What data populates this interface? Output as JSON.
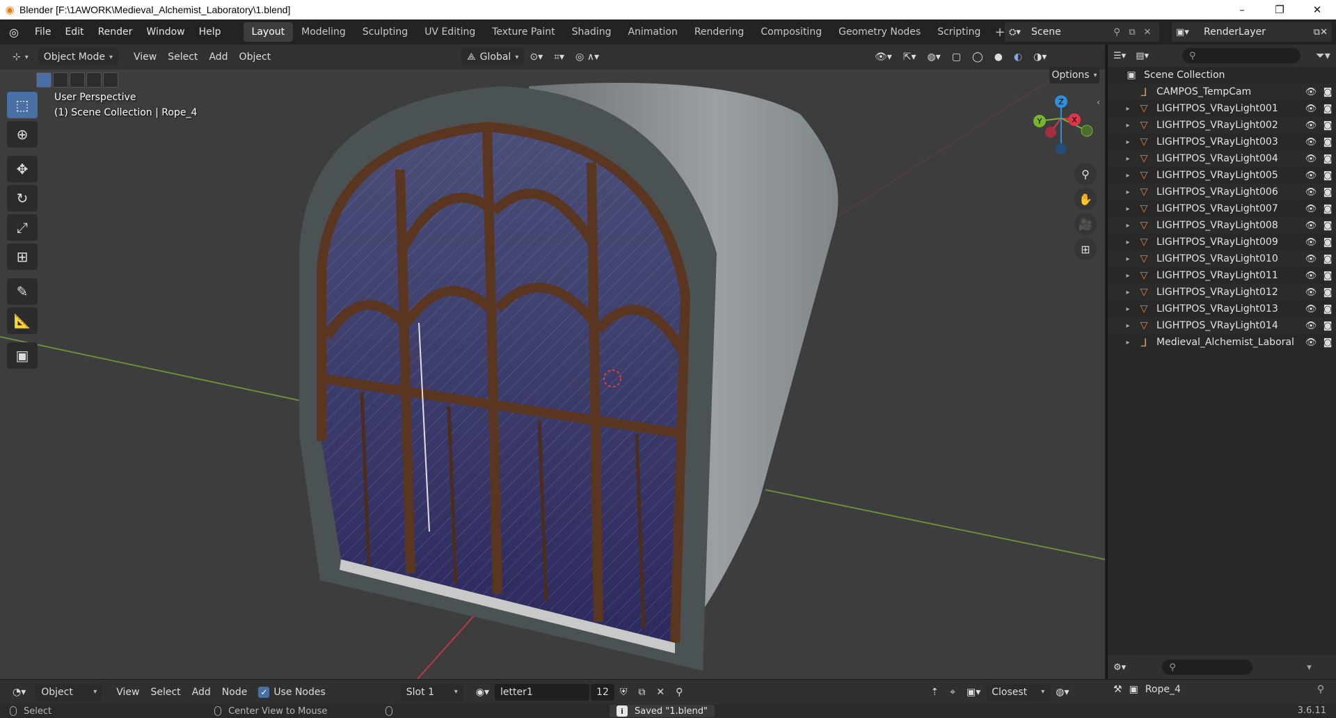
{
  "window": {
    "title": "Blender [F:\\1AWORK\\Medieval_Alchemist_Laboratory\\1.blend]",
    "controls": [
      "–",
      "❐",
      "✕"
    ]
  },
  "menus": [
    "File",
    "Edit",
    "Render",
    "Window",
    "Help"
  ],
  "workspaces": [
    "Layout",
    "Modeling",
    "Sculpting",
    "UV Editing",
    "Texture Paint",
    "Shading",
    "Animation",
    "Rendering",
    "Compositing",
    "Geometry Nodes",
    "Scripting"
  ],
  "active_workspace": "Layout",
  "scene": {
    "name": "Scene"
  },
  "view_layer": {
    "name": "RenderLayer"
  },
  "viewport": {
    "mode": "Object Mode",
    "menus": [
      "View",
      "Select",
      "Add",
      "Object"
    ],
    "transform_orientation": "Global",
    "perspective_label": "User Perspective",
    "context_label": "(1) Scene Collection | Rope_4",
    "options_label": "Options",
    "gizmo_axes": {
      "x": "X",
      "y": "Y",
      "z": "Z"
    },
    "colors": {
      "x_axis": "#e0364a",
      "y_axis": "#78b42e",
      "z_axis": "#2f8fd8",
      "background": "#3d3d3d"
    }
  },
  "tools": [
    "select-box-icon",
    "cursor-icon",
    "move-icon",
    "rotate-icon",
    "scale-icon",
    "transform-icon",
    "annotate-icon",
    "measure-icon",
    "add-cube-icon"
  ],
  "outliner": {
    "root": "Scene Collection",
    "items": [
      {
        "name": "CAMPOS_TempCam",
        "kind": "empty",
        "expandable": false
      },
      {
        "name": "LIGHTPOS_VRayLight001",
        "kind": "light",
        "expandable": true
      },
      {
        "name": "LIGHTPOS_VRayLight002",
        "kind": "light",
        "expandable": true
      },
      {
        "name": "LIGHTPOS_VRayLight003",
        "kind": "light",
        "expandable": true
      },
      {
        "name": "LIGHTPOS_VRayLight004",
        "kind": "light",
        "expandable": true
      },
      {
        "name": "LIGHTPOS_VRayLight005",
        "kind": "light",
        "expandable": true
      },
      {
        "name": "LIGHTPOS_VRayLight006",
        "kind": "light",
        "expandable": true
      },
      {
        "name": "LIGHTPOS_VRayLight007",
        "kind": "light",
        "expandable": true
      },
      {
        "name": "LIGHTPOS_VRayLight008",
        "kind": "light",
        "expandable": true
      },
      {
        "name": "LIGHTPOS_VRayLight009",
        "kind": "light",
        "expandable": true
      },
      {
        "name": "LIGHTPOS_VRayLight010",
        "kind": "light",
        "expandable": true
      },
      {
        "name": "LIGHTPOS_VRayLight011",
        "kind": "light",
        "expandable": true
      },
      {
        "name": "LIGHTPOS_VRayLight012",
        "kind": "light",
        "expandable": true
      },
      {
        "name": "LIGHTPOS_VRayLight013",
        "kind": "light",
        "expandable": true
      },
      {
        "name": "LIGHTPOS_VRayLight014",
        "kind": "light",
        "expandable": true
      },
      {
        "name": "Medieval_Alchemist_Laboral",
        "kind": "empty",
        "expandable": true
      }
    ]
  },
  "node_editor_header": {
    "editor_mode": "Object",
    "menus": [
      "View",
      "Select",
      "Add",
      "Node"
    ],
    "use_nodes_label": "Use Nodes",
    "use_nodes_checked": true,
    "slot": "Slot 1",
    "material": "letter1",
    "users": "12",
    "snap": "Closest",
    "active_object": "Rope_4"
  },
  "statusbar": {
    "select": "Select",
    "center_view": "Center View to Mouse",
    "message": "Saved \"1.blend\"",
    "version": "3.6.11"
  }
}
